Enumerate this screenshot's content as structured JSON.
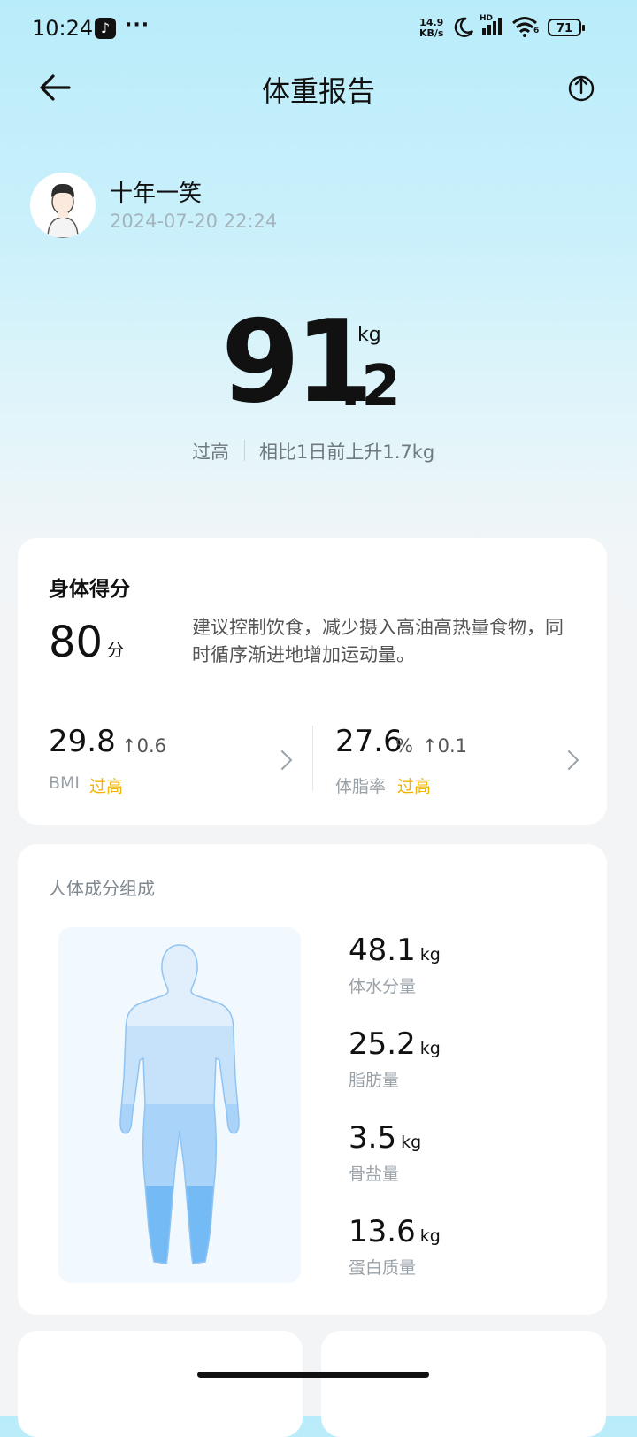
{
  "status": {
    "time": "10:24",
    "net_speed_top": "14.9",
    "net_speed_bottom": "KB/s",
    "signal": "HD",
    "wifi": "6",
    "battery": "71"
  },
  "header": {
    "title": "体重报告"
  },
  "user": {
    "name": "十年一笑",
    "datetime": "2024-07-20 22:24"
  },
  "weight": {
    "integer": "91",
    "decimal": ".2",
    "unit": "kg",
    "status": "过高",
    "comparison": "相比1日前上升1.7kg"
  },
  "score": {
    "title": "身体得分",
    "value": "80",
    "unit": "分",
    "advice": "建议控制饮食，减少摄入高油高热量食物，同时循序渐进地增加运动量。",
    "bmi": {
      "value": "29.8",
      "delta": "↑0.6",
      "label": "BMI",
      "status": "过高"
    },
    "body_fat": {
      "value": "27.6",
      "unit": "%",
      "delta": "↑0.1",
      "label": "体脂率",
      "status": "过高"
    }
  },
  "composition": {
    "title": "人体成分组成",
    "items": [
      {
        "value": "48.1",
        "unit": "kg",
        "label": "体水分量"
      },
      {
        "value": "25.2",
        "unit": "kg",
        "label": "脂肪量"
      },
      {
        "value": "3.5",
        "unit": "kg",
        "label": "骨盐量"
      },
      {
        "value": "13.6",
        "unit": "kg",
        "label": "蛋白质量"
      }
    ]
  },
  "colors": {
    "accent_warning": "#f3b300",
    "figure_light": "#d9ebfb",
    "figure_mid": "#b6dafb",
    "figure_dark": "#76bdf7"
  }
}
